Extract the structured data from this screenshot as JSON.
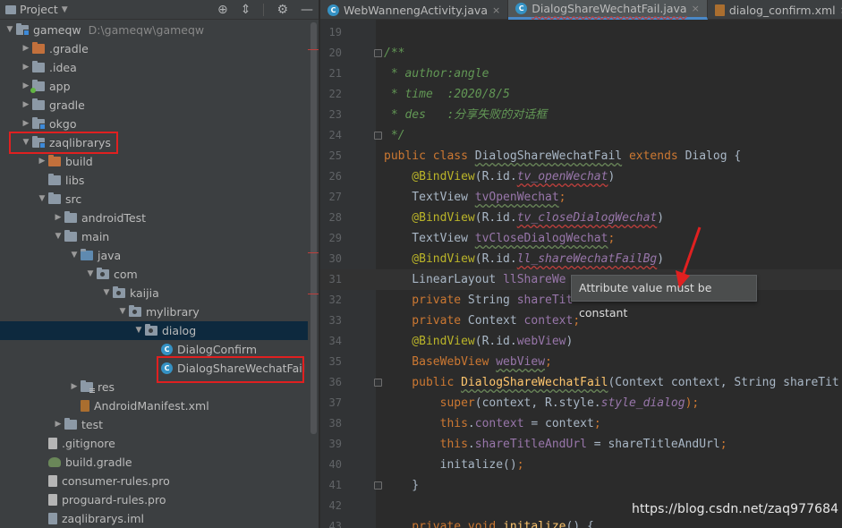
{
  "project_panel": {
    "title": "Project",
    "tree": [
      {
        "label": "gameqw",
        "detail": "D:\\gameqw\\gameqw",
        "depth": 0,
        "expanded": true,
        "icon": "module-folder-icon"
      },
      {
        "label": ".gradle",
        "depth": 1,
        "expanded": false,
        "icon": "orange-folder-icon"
      },
      {
        "label": ".idea",
        "depth": 1,
        "expanded": false,
        "icon": "folder-icon"
      },
      {
        "label": "app",
        "depth": 1,
        "expanded": false,
        "icon": "app-module-icon"
      },
      {
        "label": "gradle",
        "depth": 1,
        "expanded": false,
        "icon": "folder-icon"
      },
      {
        "label": "okgo",
        "depth": 1,
        "expanded": false,
        "icon": "module-folder-icon"
      },
      {
        "label": "zaqlibrarys",
        "depth": 1,
        "expanded": true,
        "icon": "module-folder-icon"
      },
      {
        "label": "build",
        "depth": 2,
        "expanded": false,
        "icon": "orange-folder-icon"
      },
      {
        "label": "libs",
        "depth": 2,
        "icon": "folder-icon"
      },
      {
        "label": "src",
        "depth": 2,
        "expanded": true,
        "icon": "folder-icon"
      },
      {
        "label": "androidTest",
        "depth": 3,
        "expanded": false,
        "icon": "folder-icon"
      },
      {
        "label": "main",
        "depth": 3,
        "expanded": true,
        "icon": "folder-icon"
      },
      {
        "label": "java",
        "depth": 4,
        "expanded": true,
        "icon": "source-folder-icon"
      },
      {
        "label": "com",
        "depth": 5,
        "expanded": true,
        "icon": "package-icon"
      },
      {
        "label": "kaijia",
        "depth": 6,
        "expanded": true,
        "icon": "package-icon"
      },
      {
        "label": "mylibrary",
        "depth": 7,
        "expanded": true,
        "icon": "package-icon"
      },
      {
        "label": "dialog",
        "depth": 8,
        "expanded": true,
        "icon": "package-icon",
        "selected": true
      },
      {
        "label": "DialogConfirm",
        "depth": 9,
        "icon": "class-icon"
      },
      {
        "label": "DialogShareWechatFail",
        "depth": 9,
        "icon": "class-icon"
      },
      {
        "label": "res",
        "depth": 4,
        "expanded": false,
        "icon": "resource-folder-icon"
      },
      {
        "label": "AndroidManifest.xml",
        "depth": 4,
        "icon": "manifest-file-icon"
      },
      {
        "label": "test",
        "depth": 3,
        "expanded": false,
        "icon": "folder-icon"
      },
      {
        "label": ".gitignore",
        "depth": 2,
        "icon": "text-file-icon"
      },
      {
        "label": "build.gradle",
        "depth": 2,
        "icon": "gradle-file-icon"
      },
      {
        "label": "consumer-rules.pro",
        "depth": 2,
        "icon": "text-file-icon"
      },
      {
        "label": "proguard-rules.pro",
        "depth": 2,
        "icon": "text-file-icon"
      },
      {
        "label": "zaqlibrarys.iml",
        "depth": 2,
        "icon": "module-file-icon"
      }
    ]
  },
  "tabs": [
    {
      "label": "WebWannengActivity.java",
      "icon": "class-icon",
      "active": false
    },
    {
      "label": "DialogShareWechatFail.java",
      "icon": "class-icon",
      "active": true
    },
    {
      "label": "dialog_confirm.xml",
      "icon": "xml-file-icon",
      "active": false
    }
  ],
  "editor": {
    "lines": [
      {
        "n": "19",
        "segs": []
      },
      {
        "n": "20",
        "segs": [
          {
            "t": "/**",
            "c": "cm"
          }
        ]
      },
      {
        "n": "21",
        "segs": [
          {
            "t": " * author:angle",
            "c": "cm"
          }
        ]
      },
      {
        "n": "22",
        "segs": [
          {
            "t": " * time  :2020/8/5",
            "c": "cm"
          }
        ]
      },
      {
        "n": "23",
        "segs": [
          {
            "t": " * des   :分享失败的对话框",
            "c": "cm"
          }
        ]
      },
      {
        "n": "24",
        "segs": [
          {
            "t": " */",
            "c": "cm"
          }
        ]
      },
      {
        "n": "25",
        "segs": [
          {
            "t": "public class ",
            "c": "kw"
          },
          {
            "t": "DialogShareWechatFail",
            "c": "sqg"
          },
          {
            "t": " extends ",
            "c": "kw"
          },
          {
            "t": "Dialog {",
            "c": ""
          }
        ]
      },
      {
        "n": "26",
        "segs": [
          {
            "t": "    @BindView",
            "c": "an"
          },
          {
            "t": "(R.id.",
            "c": ""
          },
          {
            "t": "tv_openWechat",
            "c": "fld it sq"
          },
          {
            "t": ")",
            "c": ""
          }
        ]
      },
      {
        "n": "27",
        "segs": [
          {
            "t": "    TextView ",
            "c": ""
          },
          {
            "t": "tvOpenWechat",
            "c": "fld sqg"
          },
          {
            "t": ";",
            "c": "kw"
          }
        ]
      },
      {
        "n": "28",
        "segs": [
          {
            "t": "    @BindView",
            "c": "an"
          },
          {
            "t": "(R.id.",
            "c": ""
          },
          {
            "t": "tv_closeDialogWechat",
            "c": "fld it sq"
          },
          {
            "t": ")",
            "c": ""
          }
        ]
      },
      {
        "n": "29",
        "segs": [
          {
            "t": "    TextView ",
            "c": ""
          },
          {
            "t": "tvCloseDialogWechat",
            "c": "fld sqg"
          },
          {
            "t": ";",
            "c": "kw"
          }
        ]
      },
      {
        "n": "30",
        "segs": [
          {
            "t": "    @BindView",
            "c": "an"
          },
          {
            "t": "(R.id.",
            "c": ""
          },
          {
            "t": "ll_shareWechatFailBg",
            "c": "fld it sq"
          },
          {
            "t": ")",
            "c": ""
          }
        ]
      },
      {
        "n": "31",
        "current": true,
        "segs": [
          {
            "t": "    LinearLayout ",
            "c": ""
          },
          {
            "t": "llShareWe",
            "c": "fld"
          }
        ]
      },
      {
        "n": "32",
        "segs": [
          {
            "t": "    private ",
            "c": "kw"
          },
          {
            "t": "String ",
            "c": ""
          },
          {
            "t": "shareTit",
            "c": "fld"
          }
        ]
      },
      {
        "n": "33",
        "segs": [
          {
            "t": "    private ",
            "c": "kw"
          },
          {
            "t": "Context ",
            "c": ""
          },
          {
            "t": "context",
            "c": "fld"
          },
          {
            "t": ";",
            "c": "kw"
          }
        ]
      },
      {
        "n": "34",
        "segs": [
          {
            "t": "    @BindView",
            "c": "an"
          },
          {
            "t": "(R.id.",
            "c": ""
          },
          {
            "t": "webView",
            "c": "fld"
          },
          {
            "t": ")",
            "c": ""
          }
        ]
      },
      {
        "n": "35",
        "segs": [
          {
            "t": "    BaseWebView ",
            "c": "kw"
          },
          {
            "t": "webView",
            "c": "fld sqg"
          },
          {
            "t": ";",
            "c": "kw"
          }
        ]
      },
      {
        "n": "36",
        "segs": [
          {
            "t": "    public ",
            "c": "kw"
          },
          {
            "t": "DialogShareWechatFail",
            "c": "mth sqg"
          },
          {
            "t": "(Context context, String shareTit",
            "c": ""
          }
        ]
      },
      {
        "n": "37",
        "segs": [
          {
            "t": "        super",
            "c": "kw"
          },
          {
            "t": "(context, R.style.",
            "c": ""
          },
          {
            "t": "style_dialog",
            "c": "fld it"
          },
          {
            "t": ");",
            "c": "kw"
          }
        ]
      },
      {
        "n": "38",
        "segs": [
          {
            "t": "        this",
            "c": "kw"
          },
          {
            "t": ".",
            "c": ""
          },
          {
            "t": "context",
            "c": "fld"
          },
          {
            "t": " = context",
            "c": ""
          },
          {
            "t": ";",
            "c": "kw"
          }
        ]
      },
      {
        "n": "39",
        "segs": [
          {
            "t": "        this",
            "c": "kw"
          },
          {
            "t": ".",
            "c": ""
          },
          {
            "t": "shareTitleAndUrl",
            "c": "fld"
          },
          {
            "t": " = shareTitleAndUrl",
            "c": ""
          },
          {
            "t": ";",
            "c": "kw"
          }
        ]
      },
      {
        "n": "40",
        "segs": [
          {
            "t": "        initalize()",
            "c": ""
          },
          {
            "t": ";",
            "c": "kw"
          }
        ]
      },
      {
        "n": "41",
        "segs": [
          {
            "t": "    }",
            "c": ""
          }
        ]
      },
      {
        "n": "42",
        "segs": []
      },
      {
        "n": "43",
        "segs": [
          {
            "t": "    private void ",
            "c": "kw"
          },
          {
            "t": "initalize",
            "c": "mth"
          },
          {
            "t": "() {",
            "c": ""
          }
        ]
      }
    ]
  },
  "tooltip": {
    "text": "Attribute value must be constant"
  },
  "watermark": "https://blog.csdn.net/zaq977684",
  "colors": {
    "annotation_red": "#e02020",
    "selection": "#0d293e",
    "accent_tab": "#4a88c7"
  }
}
